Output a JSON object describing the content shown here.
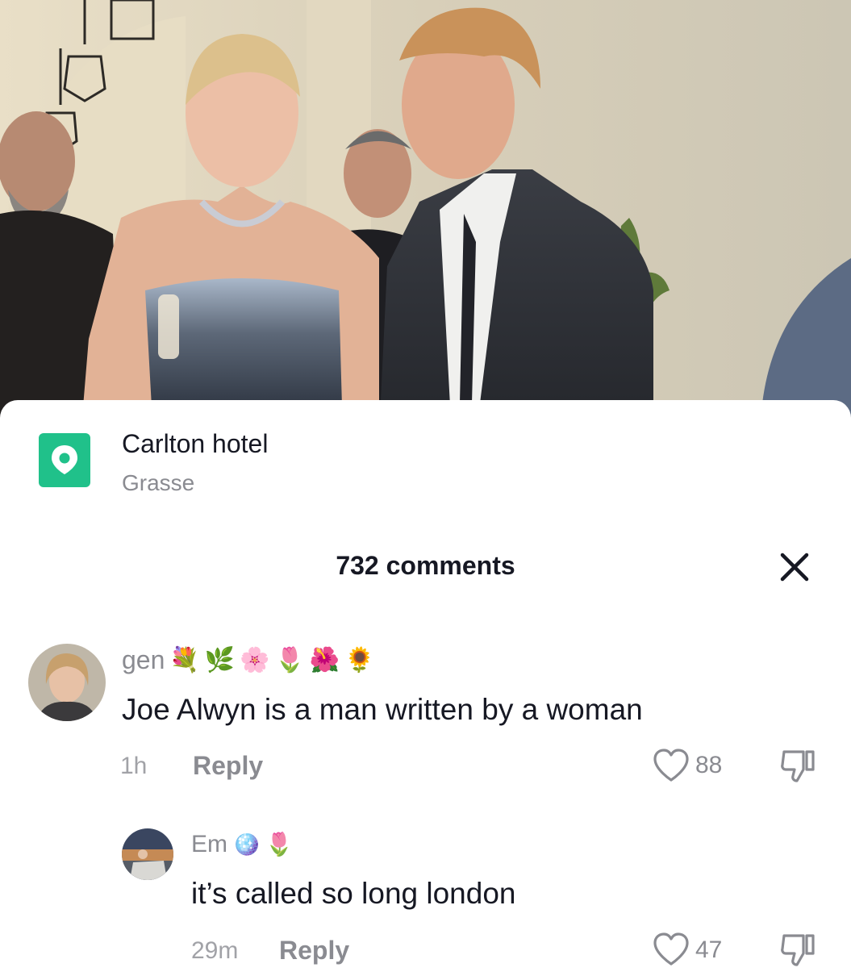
{
  "location": {
    "title": "Carlton hotel",
    "subtitle": "Grasse",
    "icon": "map-pin-icon",
    "icon_bg": "#20c18a"
  },
  "comments_header": {
    "count_text": "732 comments",
    "close_icon": "close-icon"
  },
  "comments": [
    {
      "username": "gen",
      "username_emojis": [
        "💐",
        "🌿",
        "🌸",
        "🌷",
        "🌺",
        "🌻"
      ],
      "text": "Joe Alwyn is a man written by a woman",
      "time": "1h",
      "reply_label": "Reply",
      "likes": "88"
    },
    {
      "username": "Em",
      "username_emojis": [
        "🪩",
        "🌷"
      ],
      "text": "it’s called so long london",
      "time": "29m",
      "reply_label": "Reply",
      "likes": "47"
    }
  ],
  "colors": {
    "primary_text": "#161823",
    "secondary_text": "#8a8b91",
    "accent_green": "#20c18a"
  }
}
